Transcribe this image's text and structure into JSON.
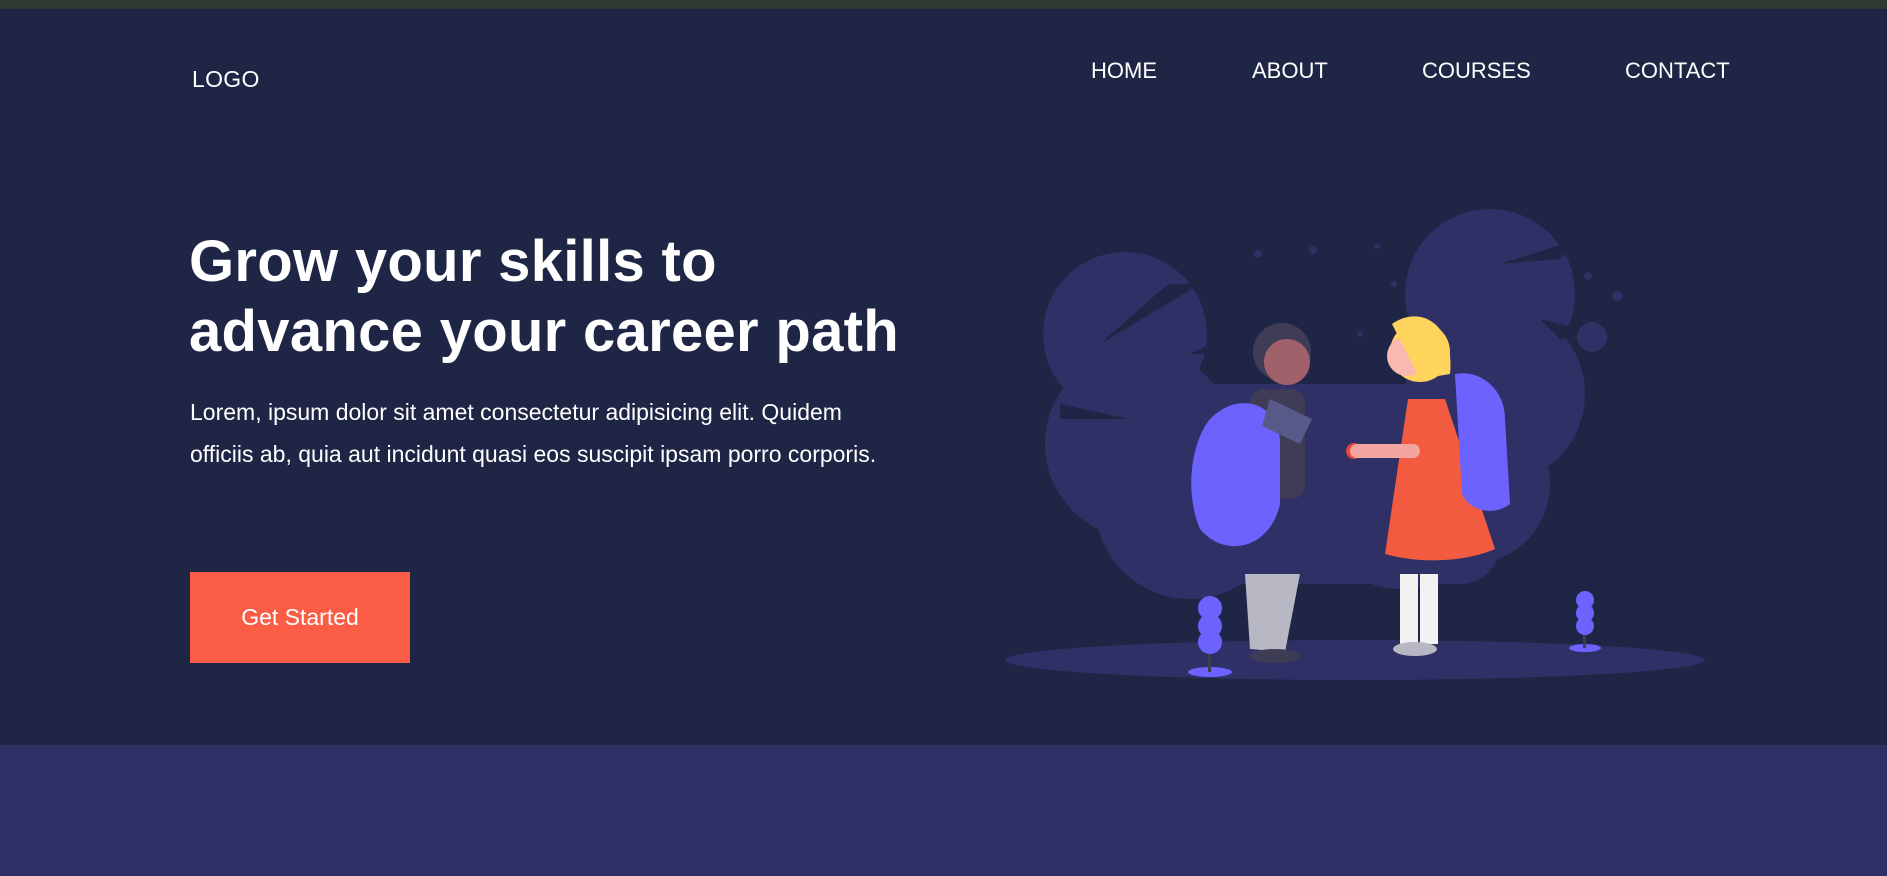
{
  "header": {
    "logo": "LOGO",
    "nav": [
      {
        "label": "HOME"
      },
      {
        "label": "ABOUT"
      },
      {
        "label": "COURSES"
      },
      {
        "label": "CONTACT"
      }
    ]
  },
  "hero": {
    "headline_line1": "Grow your skills to",
    "headline_line2": "advance your career path",
    "lead": "Lorem, ipsum dolor sit amet consectetur adipisicing elit. Quidem officiis ab, quia aut incidunt quasi eos suscipit ipsam porro corporis.",
    "cta_label": "Get Started",
    "illustration": "students-with-backpacks-illustration"
  },
  "colors": {
    "background": "#1f2544",
    "accent": "#fa5c45",
    "illustration_purple": "#6c63ff",
    "lower_band": "#2f3166"
  }
}
